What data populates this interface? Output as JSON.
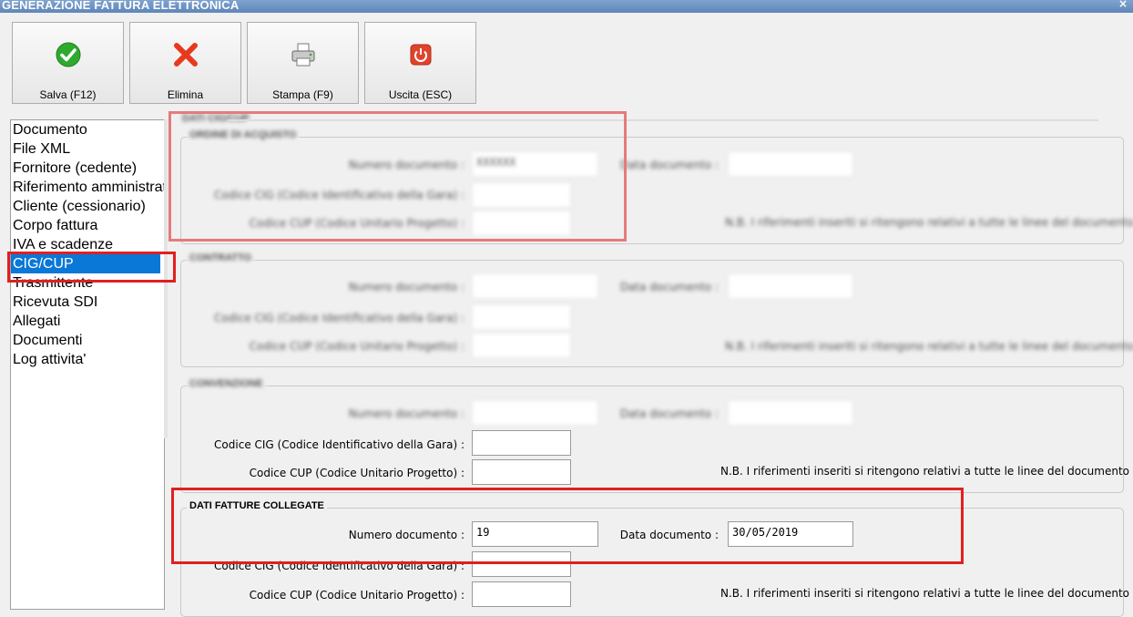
{
  "window": {
    "title": "GENERAZIONE FATTURA ELETTRONICA",
    "close_glyph": "×"
  },
  "toolbar": {
    "save_label": "Salva (F12)",
    "delete_label": "Elimina",
    "print_label": "Stampa (F9)",
    "exit_label": "Uscita (ESC)",
    "icons": [
      "check-circle-icon",
      "red-x-icon",
      "printer-icon",
      "power-icon"
    ]
  },
  "nav": {
    "items": [
      {
        "label": "Documento"
      },
      {
        "label": "File XML"
      },
      {
        "label": "Fornitore (cedente)"
      },
      {
        "label": "Riferimento amministrativo"
      },
      {
        "label": "Cliente (cessionario)"
      },
      {
        "label": "Corpo fattura"
      },
      {
        "label": "IVA e scadenze"
      },
      {
        "label": "CIG/CUP"
      },
      {
        "label": "Trasmittente"
      },
      {
        "label": "Ricevuta SDI"
      },
      {
        "label": "Allegati"
      },
      {
        "label": "Documenti"
      },
      {
        "label": "Log attivita'"
      }
    ],
    "selected_index": 7
  },
  "groups": {
    "top_header": "DATI CIG/CUP",
    "g1": {
      "title": "ORDINE DI ACQUISTO",
      "numero_label": "Numero documento :",
      "numero_value": "XXXXXX",
      "data_label": "Data documento :",
      "cig_label": "Codice CIG (Codice Identificativo della Gara) :",
      "cup_label": "Codice CUP (Codice Unitario Progetto) :",
      "note": "N.B. I riferimenti inseriti si ritengono relativi a tutte le linee del documento"
    },
    "g2": {
      "title": "CONTRATTO",
      "numero_label": "Numero documento :",
      "data_label": "Data documento :",
      "cig_label": "Codice CIG (Codice Identificativo della Gara) :",
      "cup_label": "Codice CUP (Codice Unitario Progetto) :",
      "note": "N.B. I riferimenti inseriti si ritengono relativi a tutte le linee del documento"
    },
    "g3": {
      "title": "CONVENZIONE",
      "numero_label": "Numero documento :",
      "data_label": "Data documento :",
      "cig_label": "Codice CIG (Codice Identificativo della Gara) :",
      "cup_label": "Codice CUP (Codice Unitario Progetto) :",
      "note": "N.B. I riferimenti inseriti si ritengono relativi a tutte le linee del documento"
    },
    "g4": {
      "title": "DATI FATTURE COLLEGATE",
      "numero_label": "Numero documento :",
      "numero_value": "19",
      "data_label": "Data documento :",
      "data_value": "30/05/2019",
      "cig_label": "Codice CIG (Codice Identificativo della Gara) :",
      "cup_label": "Codice CUP (Codice Unitario Progetto) :",
      "note": "N.B. I riferimenti inseriti si ritengono relativi a tutte le linee del documento"
    }
  },
  "colors": {
    "selection": "#0a78d7",
    "highlight": "#e02020",
    "titlebar": "#6b92c4"
  }
}
